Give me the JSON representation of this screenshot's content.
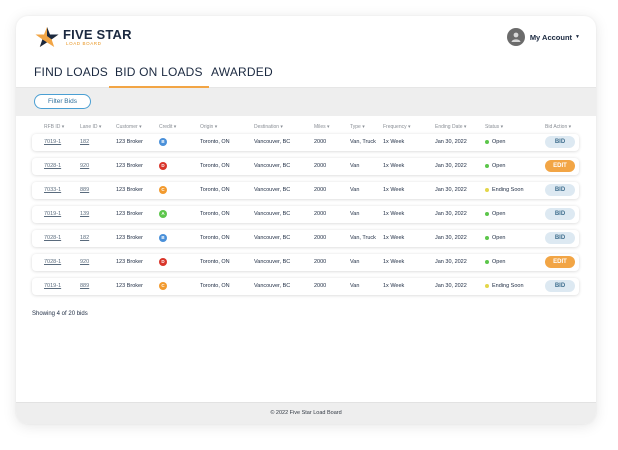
{
  "brand": {
    "name": "FIVE STAR",
    "tagline": "LOAD BOARD",
    "colors": {
      "navy": "#1b2940",
      "orange": "#f2a545",
      "blue": "#4a9fd3"
    }
  },
  "account": {
    "label": "My Account",
    "icon": "user-avatar-icon"
  },
  "tabs": [
    {
      "label": "FIND LOADS",
      "active": false
    },
    {
      "label": "BID ON LOADS",
      "active": true
    },
    {
      "label": "AWARDED",
      "active": false
    }
  ],
  "filter": {
    "label": "Filter Bids"
  },
  "table": {
    "columns": [
      "RFB ID",
      "Lane ID",
      "Customer",
      "Credit",
      "Origin",
      "Destination",
      "Miles",
      "Type",
      "Frequency",
      "Ending Date",
      "Status",
      "Bid Action"
    ],
    "rows": [
      {
        "rfb": "7019-1",
        "lane": "182",
        "customer": "123 Broker",
        "credit": "B",
        "credit_color": "#4a90d9",
        "origin": "Toronto, ON",
        "destination": "Vancouver, BC",
        "miles": "2000",
        "type": "Van, Truck",
        "frequency": "1x Week",
        "ending": "Jan 30, 2022",
        "status": "Open",
        "status_color": "#5cc64b",
        "action": "BID",
        "action_kind": "bid"
      },
      {
        "rfb": "7028-1",
        "lane": "920",
        "customer": "123 Broker",
        "credit": "D",
        "credit_color": "#d9352a",
        "origin": "Toronto, ON",
        "destination": "Vancouver, BC",
        "miles": "2000",
        "type": "Van",
        "frequency": "1x Week",
        "ending": "Jan 30, 2022",
        "status": "Open",
        "status_color": "#5cc64b",
        "action": "EDIT",
        "action_kind": "edit"
      },
      {
        "rfb": "7033-1",
        "lane": "889",
        "customer": "123 Broker",
        "credit": "C",
        "credit_color": "#f29a2e",
        "origin": "Toronto, ON",
        "destination": "Vancouver, BC",
        "miles": "2000",
        "type": "Van",
        "frequency": "1x Week",
        "ending": "Jan 30, 2022",
        "status": "Ending Soon",
        "status_color": "#e3d64a",
        "action": "BID",
        "action_kind": "bid"
      },
      {
        "rfb": "7019-1",
        "lane": "139",
        "customer": "123 Broker",
        "credit": "A",
        "credit_color": "#5cc64b",
        "origin": "Toronto, ON",
        "destination": "Vancouver, BC",
        "miles": "2000",
        "type": "Van",
        "frequency": "1x Week",
        "ending": "Jan 30, 2022",
        "status": "Open",
        "status_color": "#5cc64b",
        "action": "BID",
        "action_kind": "bid"
      },
      {
        "rfb": "7028-1",
        "lane": "182",
        "customer": "123 Broker",
        "credit": "B",
        "credit_color": "#4a90d9",
        "origin": "Toronto, ON",
        "destination": "Vancouver, BC",
        "miles": "2000",
        "type": "Van, Truck",
        "frequency": "1x Week",
        "ending": "Jan 30, 2022",
        "status": "Open",
        "status_color": "#5cc64b",
        "action": "BID",
        "action_kind": "bid"
      },
      {
        "rfb": "7028-1",
        "lane": "920",
        "customer": "123 Broker",
        "credit": "D",
        "credit_color": "#d9352a",
        "origin": "Toronto, ON",
        "destination": "Vancouver, BC",
        "miles": "2000",
        "type": "Van",
        "frequency": "1x Week",
        "ending": "Jan 30, 2022",
        "status": "Open",
        "status_color": "#5cc64b",
        "action": "EDIT",
        "action_kind": "edit"
      },
      {
        "rfb": "7019-1",
        "lane": "889",
        "customer": "123 Broker",
        "credit": "C",
        "credit_color": "#f29a2e",
        "origin": "Toronto, ON",
        "destination": "Vancouver, BC",
        "miles": "2000",
        "type": "Van",
        "frequency": "1x Week",
        "ending": "Jan 30, 2022",
        "status": "Ending Soon",
        "status_color": "#e3d64a",
        "action": "BID",
        "action_kind": "bid"
      }
    ]
  },
  "summary": "Showing 4 of 20 bids",
  "footer": "© 2022 Five Star Load Board"
}
